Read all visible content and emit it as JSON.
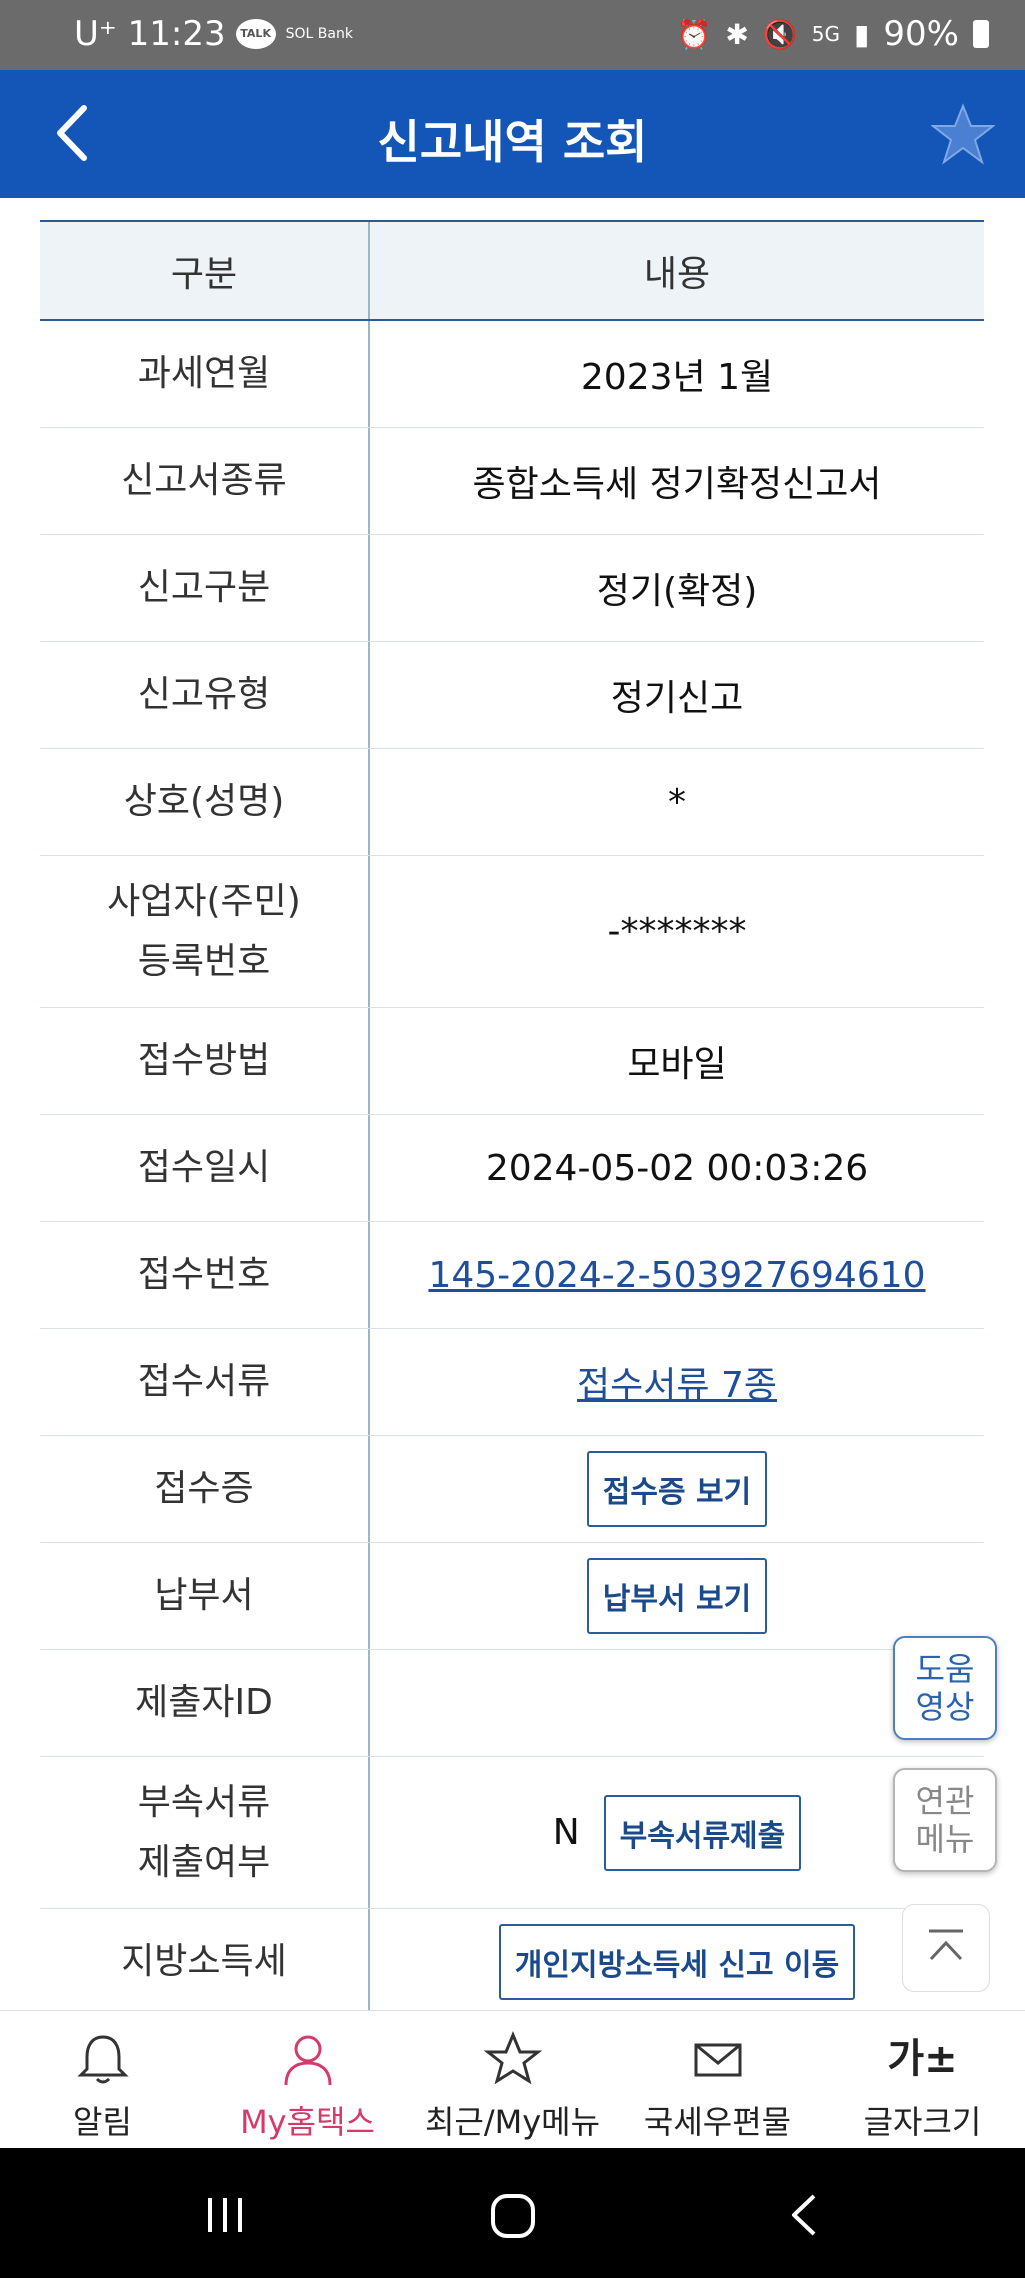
{
  "status": {
    "time": "U⁺ 11:23",
    "talk": "TALK",
    "sol": "SOL Bank",
    "battery": "90%",
    "network": "5G"
  },
  "header": {
    "title": "신고내역 조회"
  },
  "table": {
    "head": [
      "구분",
      "내용"
    ],
    "rows": [
      {
        "label": "과세연월",
        "value": "2023년 1월"
      },
      {
        "label": "신고서종류",
        "value": "종합소득세 정기확정신고서"
      },
      {
        "label": "신고구분",
        "value": "정기(확정)"
      },
      {
        "label": "신고유형",
        "value": "정기신고"
      },
      {
        "label": "상호(성명)",
        "value": "*"
      },
      {
        "label1": "사업자(주민)",
        "label2": "등록번호",
        "value": "-*******"
      },
      {
        "label": "접수방법",
        "value": "모바일"
      },
      {
        "label": "접수일시",
        "value": "2024-05-02 00:03:26"
      },
      {
        "label": "접수번호",
        "value": "145-2024-2-503927694610"
      },
      {
        "label": "접수서류",
        "value": "접수서류 7종"
      },
      {
        "label": "접수증",
        "button": "접수증 보기"
      },
      {
        "label": "납부서",
        "button": "납부서 보기"
      },
      {
        "label": "제출자ID",
        "value": ""
      },
      {
        "label1": "부속서류",
        "label2": "제출여부",
        "value": "N",
        "button": "부속서류제출"
      },
      {
        "label": "지방소득세",
        "button": "개인지방소득세 신고 이동"
      }
    ]
  },
  "fab": {
    "help1": "도움",
    "help2": "영상",
    "related1": "연관",
    "related2": "메뉴"
  },
  "nav": [
    {
      "label": "알림",
      "icon": "bell-icon"
    },
    {
      "label": "My홈택스",
      "icon": "person-icon",
      "color": "#d63a6a"
    },
    {
      "label": "최근/My메뉴",
      "icon": "star-icon"
    },
    {
      "label": "국세우편물",
      "icon": "mail-icon"
    },
    {
      "label": "글자크기",
      "icon": "font-size-icon",
      "glyph": "가±"
    }
  ]
}
